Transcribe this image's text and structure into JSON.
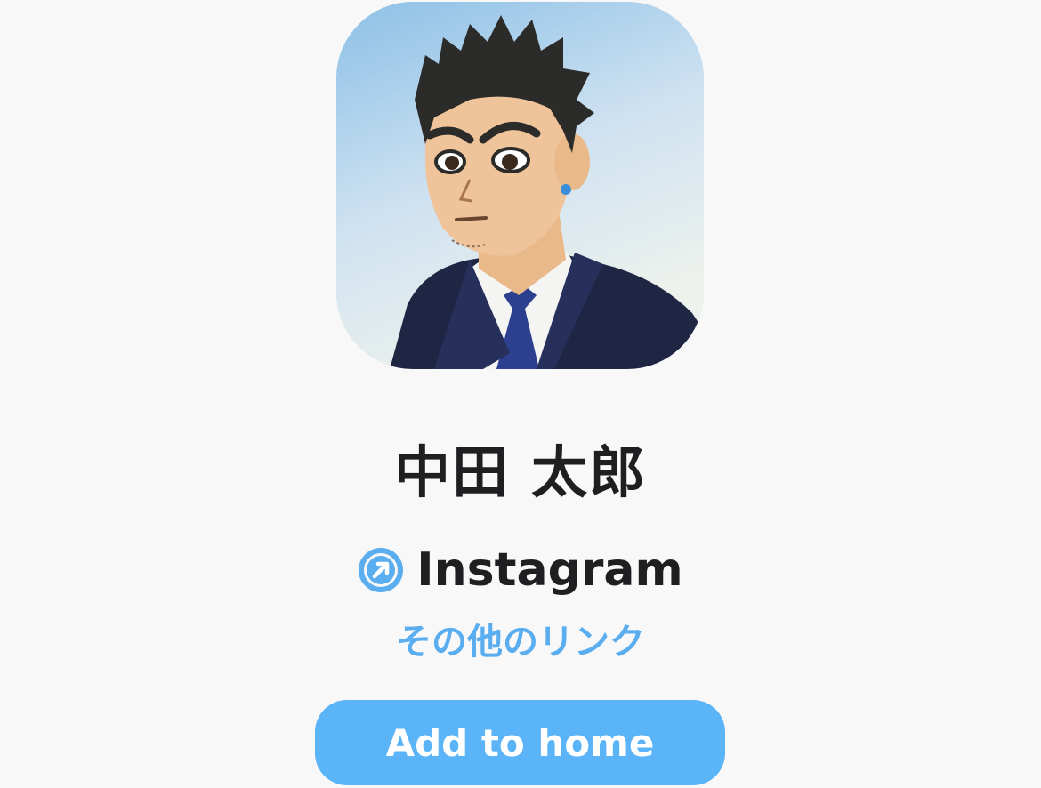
{
  "profile": {
    "avatar_alt": "avatar",
    "name": "中田 太郎"
  },
  "links": [
    {
      "icon": "external-link-arrow-icon",
      "label": "Instagram"
    }
  ],
  "more_links_label": "その他のリンク",
  "add_home_label": "Add to home",
  "colors": {
    "background": "#f8f8f9",
    "text": "#1f1f21",
    "accent": "#5aaef0",
    "button": "#5bb4f7",
    "button_text": "#ffffff"
  }
}
